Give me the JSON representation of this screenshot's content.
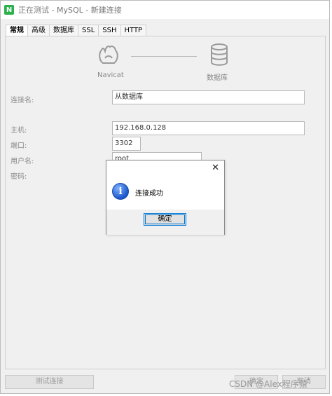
{
  "window": {
    "title": "正在测试 - MySQL - 新建连接"
  },
  "tabs": [
    "常规",
    "高级",
    "数据库",
    "SSL",
    "SSH",
    "HTTP"
  ],
  "flow": {
    "left_label": "Navicat",
    "right_label": "数据库"
  },
  "form": {
    "connection_name": {
      "label": "连接名:",
      "value": "从数据库"
    },
    "host": {
      "label": "主机:",
      "value": "192.168.0.128"
    },
    "port": {
      "label": "端口:",
      "value": "3302"
    },
    "username": {
      "label": "用户名:",
      "value": "root"
    },
    "password": {
      "label": "密码:"
    }
  },
  "buttons": {
    "test_connection": "测试连接",
    "ok": "确定",
    "cancel": "取消"
  },
  "dialog": {
    "message": "连接成功",
    "ok_label": "确定",
    "close_symbol": "✕",
    "info_symbol": "i"
  },
  "watermark": "CSDN @Alex程序猿"
}
